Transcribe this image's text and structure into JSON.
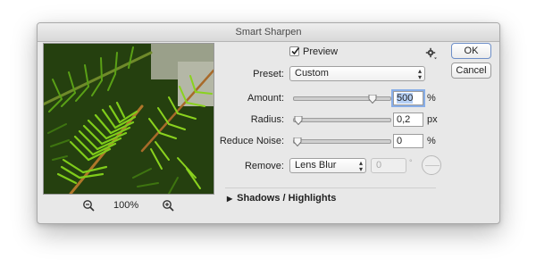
{
  "window": {
    "title": "Smart Sharpen"
  },
  "preview_image": {
    "description": "close-up of green fir branches"
  },
  "zoom": {
    "level": "100%",
    "zoom_out_icon": "zoom-out-icon",
    "zoom_in_icon": "zoom-in-icon"
  },
  "preview_toggle": {
    "label": "Preview",
    "checked": true
  },
  "settings_icon": "gear-icon",
  "buttons": {
    "ok": "OK",
    "cancel": "Cancel"
  },
  "preset": {
    "label": "Preset:",
    "value": "Custom"
  },
  "amount": {
    "label": "Amount:",
    "value": "500",
    "unit": "%",
    "slider_fraction": 0.84
  },
  "radius": {
    "label": "Radius:",
    "value": "0,2",
    "unit": "px",
    "slider_fraction": 0.01
  },
  "reduce_noise": {
    "label": "Reduce Noise:",
    "value": "0",
    "unit": "%",
    "slider_fraction": 0.0
  },
  "remove": {
    "label": "Remove:",
    "value": "Lens Blur",
    "angle_value": "0",
    "angle_unit": "°"
  },
  "shadows_highlights": {
    "label": "Shadows / Highlights",
    "expanded": false
  }
}
